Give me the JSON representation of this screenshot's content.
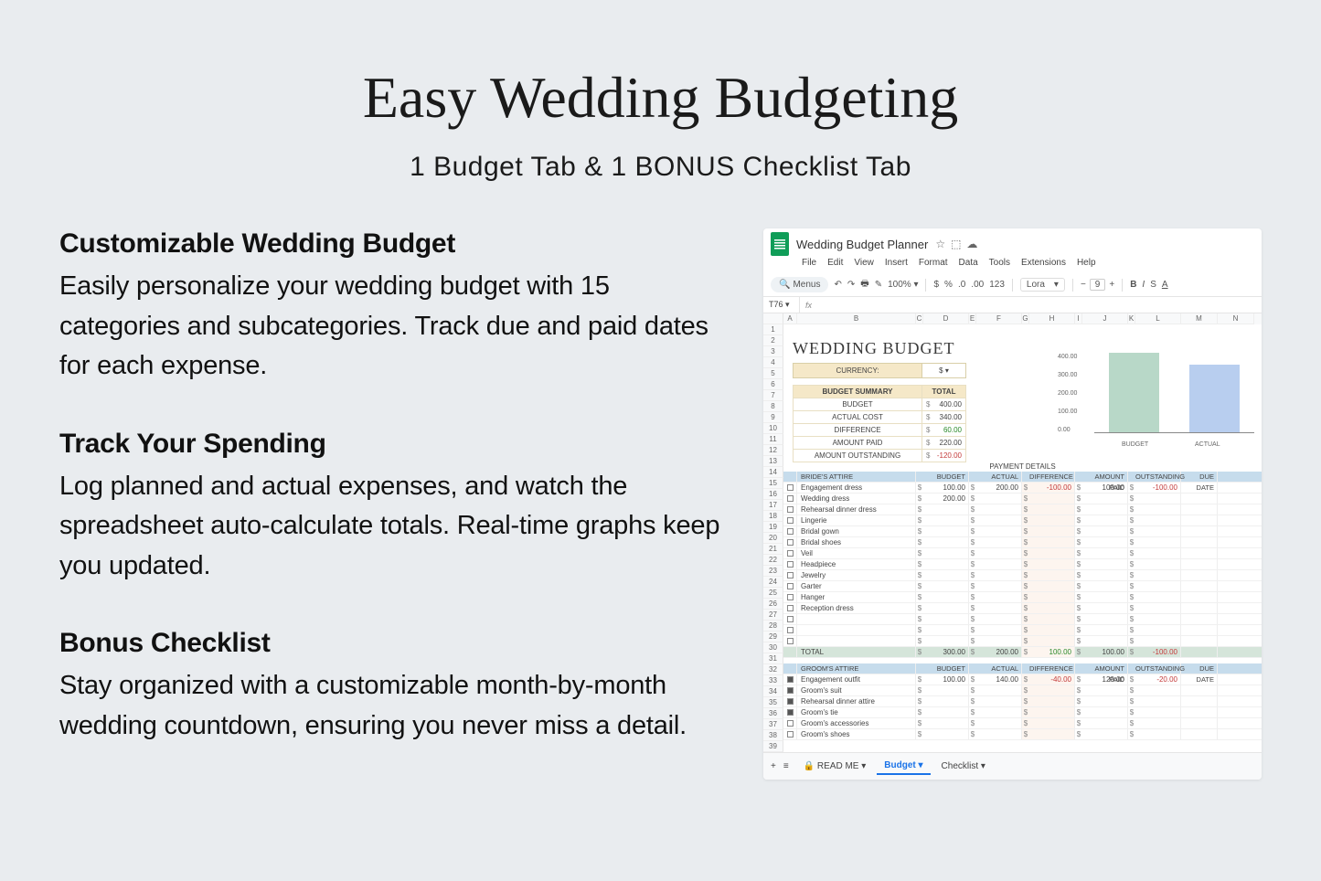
{
  "title": "Easy Wedding Budgeting",
  "subtitle": "1 Budget Tab & 1 BONUS Checklist Tab",
  "sections": [
    {
      "heading": "Customizable Wedding Budget",
      "body": "Easily personalize your wedding budget with 15 categories and subcategories. Track due and paid dates for each expense."
    },
    {
      "heading": "Track Your Spending",
      "body": "Log planned and actual expenses, and watch the spreadsheet auto-calculate totals. Real-time graphs keep you updated."
    },
    {
      "heading": "Bonus Checklist",
      "body": "Stay organized with a customizable month-by-month wedding countdown, ensuring you never miss a detail."
    }
  ],
  "sheets": {
    "docTitle": "Wedding Budget Planner",
    "menus": [
      "File",
      "Edit",
      "View",
      "Insert",
      "Format",
      "Data",
      "Tools",
      "Extensions",
      "Help"
    ],
    "searchPlaceholder": "Menus",
    "zoom": "100%",
    "font": "Lora",
    "fontSize": "9",
    "cellRef": "T76",
    "cols": [
      "A",
      "B",
      "C",
      "D",
      "E",
      "F",
      "G",
      "H",
      "I",
      "J",
      "K",
      "L",
      "M",
      "N"
    ],
    "sheetTitle": "WEDDING BUDGET",
    "currencyLabel": "CURRENCY:",
    "currencyVal": "$",
    "summaryHeader": {
      "l": "BUDGET SUMMARY",
      "r": "TOTAL"
    },
    "summary": [
      {
        "l": "BUDGET",
        "v": "400.00",
        "cls": ""
      },
      {
        "l": "ACTUAL COST",
        "v": "340.00",
        "cls": ""
      },
      {
        "l": "DIFFERENCE",
        "v": "60.00",
        "cls": "green"
      },
      {
        "l": "AMOUNT PAID",
        "v": "220.00",
        "cls": ""
      },
      {
        "l": "AMOUNT OUTSTANDING",
        "v": "-120.00",
        "cls": "red"
      }
    ],
    "chartYLabels": [
      "400.00",
      "300.00",
      "200.00",
      "100.00",
      "0.00"
    ],
    "chartXLabels": [
      "BUDGET",
      "ACTUAL"
    ],
    "paymentDetails": "PAYMENT DETAILS",
    "tableCols": [
      "BUDGET",
      "ACTUAL",
      "DIFFERENCE",
      "AMOUNT PAID",
      "OUTSTANDING",
      "DUE DATE"
    ],
    "section1": {
      "name": "BRIDE'S ATTIRE",
      "chk": "✓"
    },
    "items1": [
      {
        "chk": false,
        "name": "Engagement dress",
        "b": "100.00",
        "a": "200.00",
        "d": "-100.00",
        "p": "100.00",
        "o": "-100.00"
      },
      {
        "chk": false,
        "name": "Wedding dress",
        "b": "200.00",
        "a": "",
        "d": "",
        "p": "",
        "o": ""
      },
      {
        "chk": false,
        "name": "Rehearsal dinner dress",
        "b": "",
        "a": "",
        "d": "",
        "p": "",
        "o": ""
      },
      {
        "chk": false,
        "name": "Lingerie",
        "b": "",
        "a": "",
        "d": "",
        "p": "",
        "o": ""
      },
      {
        "chk": false,
        "name": "Bridal gown",
        "b": "",
        "a": "",
        "d": "",
        "p": "",
        "o": ""
      },
      {
        "chk": false,
        "name": "Bridal shoes",
        "b": "",
        "a": "",
        "d": "",
        "p": "",
        "o": ""
      },
      {
        "chk": false,
        "name": "Veil",
        "b": "",
        "a": "",
        "d": "",
        "p": "",
        "o": ""
      },
      {
        "chk": false,
        "name": "Headpiece",
        "b": "",
        "a": "",
        "d": "",
        "p": "",
        "o": ""
      },
      {
        "chk": false,
        "name": "Jewelry",
        "b": "",
        "a": "",
        "d": "",
        "p": "",
        "o": ""
      },
      {
        "chk": false,
        "name": "Garter",
        "b": "",
        "a": "",
        "d": "",
        "p": "",
        "o": ""
      },
      {
        "chk": false,
        "name": "Hanger",
        "b": "",
        "a": "",
        "d": "",
        "p": "",
        "o": ""
      },
      {
        "chk": false,
        "name": "Reception dress",
        "b": "",
        "a": "",
        "d": "",
        "p": "",
        "o": ""
      },
      {
        "chk": false,
        "name": "",
        "b": "",
        "a": "",
        "d": "",
        "p": "",
        "o": ""
      },
      {
        "chk": false,
        "name": "",
        "b": "",
        "a": "",
        "d": "",
        "p": "",
        "o": ""
      },
      {
        "chk": false,
        "name": "",
        "b": "",
        "a": "",
        "d": "",
        "p": "",
        "o": ""
      }
    ],
    "total1": {
      "name": "TOTAL",
      "b": "300.00",
      "a": "200.00",
      "d": "100.00",
      "p": "100.00",
      "o": "-100.00"
    },
    "section2": {
      "name": "GROOM'S ATTIRE",
      "chk": "✓"
    },
    "items2": [
      {
        "chk": true,
        "name": "Engagement outfit",
        "b": "100.00",
        "a": "140.00",
        "d": "-40.00",
        "p": "120.00",
        "o": "-20.00"
      },
      {
        "chk": true,
        "name": "Groom's suit",
        "b": "",
        "a": "",
        "d": "",
        "p": "",
        "o": ""
      },
      {
        "chk": true,
        "name": "Rehearsal dinner attire",
        "b": "",
        "a": "",
        "d": "",
        "p": "",
        "o": ""
      },
      {
        "chk": true,
        "name": "Groom's tie",
        "b": "",
        "a": "",
        "d": "",
        "p": "",
        "o": ""
      },
      {
        "chk": false,
        "name": "Groom's accessories",
        "b": "",
        "a": "",
        "d": "",
        "p": "",
        "o": ""
      },
      {
        "chk": false,
        "name": "Groom's shoes",
        "b": "",
        "a": "",
        "d": "",
        "p": "",
        "o": ""
      }
    ],
    "tabs": [
      {
        "label": "READ ME",
        "locked": true,
        "active": false
      },
      {
        "label": "Budget",
        "locked": false,
        "active": true
      },
      {
        "label": "Checklist",
        "locked": false,
        "active": false
      }
    ]
  },
  "chart_data": {
    "type": "bar",
    "categories": [
      "BUDGET",
      "ACTUAL"
    ],
    "values": [
      400,
      340
    ],
    "ylim": [
      0,
      400
    ],
    "ylabel": "",
    "xlabel": "",
    "title": ""
  }
}
